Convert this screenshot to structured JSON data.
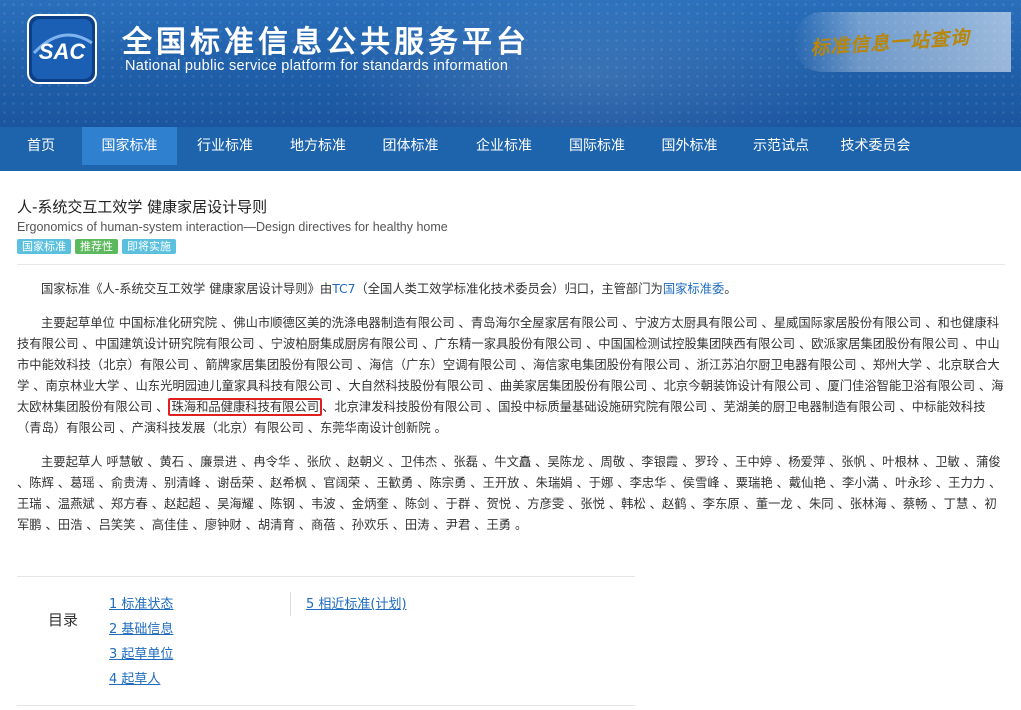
{
  "header": {
    "logo_text": "SAC",
    "title_cn": "全国标准信息公共服务平台",
    "title_en": "National public service platform  for standards information",
    "slogan": "标准信息一站查询"
  },
  "nav": {
    "items": [
      {
        "label": "首页"
      },
      {
        "label": "国家标准"
      },
      {
        "label": "行业标准"
      },
      {
        "label": "地方标准"
      },
      {
        "label": "团体标准"
      },
      {
        "label": "企业标准"
      },
      {
        "label": "国际标准"
      },
      {
        "label": "国外标准"
      },
      {
        "label": "示范试点"
      },
      {
        "label": "技术委员会"
      }
    ],
    "active_index": 1
  },
  "doc": {
    "title": "人-系统交互工效学 健康家居设计导则",
    "subtitle": "Ergonomics of human-system interaction—Design directives for healthy home",
    "badges": [
      "国家标准",
      "推荐性",
      "即将实施"
    ]
  },
  "intro": {
    "prefix": "国家标准《人-系统交互工效学 健康家居设计导则》由",
    "tc_link": "TC7",
    "middle": "（全国人类工效学标准化技术委员会）归口，主管部门为",
    "dept_link": "国家标准委",
    "suffix": "。"
  },
  "drafting_units": {
    "before": "主要起草单位 中国标准化研究院 、佛山市顺德区美的洗涤电器制造有限公司 、青岛海尔全屋家居有限公司 、宁波方太厨具有限公司 、星威国际家居股份有限公司 、和也健康科技有限公司 、中国建筑设计研究院有限公司 、宁波柏厨集成厨房有限公司 、广东精一家具股份有限公司 、中国国检测试控股集团陕西有限公司 、欧派家居集团股份有限公司 、中山市中能效科技（北京）有限公司 、箭牌家居集团股份有限公司 、海信（广东）空调有限公司 、海信家电集团股份有限公司 、浙江苏泊尔厨卫电器有限公司 、郑州大学 、北京联合大学 、南京林业大学 、山东光明园迪儿童家具科技有限公司 、大自然科技股份有限公司 、曲美家居集团股份有限公司 、北京今朝装饰设计有限公司 、厦门佳浴智能卫浴有限公司 、海太欧林集团股份有限公司 、",
    "highlighted": "珠海和品健康科技有限公司",
    "after": "、北京津发科技股份有限公司 、国投中标质量基础设施研究院有限公司 、芜湖美的厨卫电器制造有限公司 、中标能效科技（青岛）有限公司 、产演科技发展（北京）有限公司 、东莞华南设计创新院 。"
  },
  "drafters": {
    "text": "主要起草人 呼慧敏 、黄石 、廉景进 、冉令华 、张欣 、赵朝义 、卫伟杰 、张磊 、牛文矗 、吴陈龙 、周敬 、李银霞 、罗玲 、王中婷 、杨爱萍 、张帆 、叶根林 、卫敏 、蒲俊 、陈辉 、葛瑶 、俞贵涛 、别清峰 、谢岳荣 、赵希枫 、官阔荣 、王歓勇 、陈宗勇 、王开放 、朱瑞娟 、于娜 、李忠华 、侯雪峰 、粟瑞艳 、戴仙艳 、李小満 、叶永珍 、王力力 、王瑞 、温燕斌 、郑方春 、赵起超 、吴海耀 、陈钢 、韦波 、金炳奎 、陈剑 、于群 、贺悦 、方彦雯 、张悦 、韩松 、赵鹤 、李东原 、董一龙 、朱同 、张林海 、蔡畅 、丁慧 、初军鹏 、田浩 、吕笑笑 、高佳佳 、廖钟财 、胡清育 、商蓓 、孙欢乐 、田涛 、尹君 、王勇 。"
  },
  "toc": {
    "label": "目录",
    "items": [
      {
        "label": "1  标准状态"
      },
      {
        "label": "2  基础信息"
      },
      {
        "label": "3  起草单位"
      },
      {
        "label": "4  起草人"
      },
      {
        "label": "5  相近标准(计划)"
      }
    ]
  },
  "colors": {
    "header_bg": "#1f5ea8",
    "nav_bg": "#1e64ac",
    "nav_active": "#2f80cf",
    "link": "#1e6bbf",
    "highlight_border": "#e02020"
  }
}
